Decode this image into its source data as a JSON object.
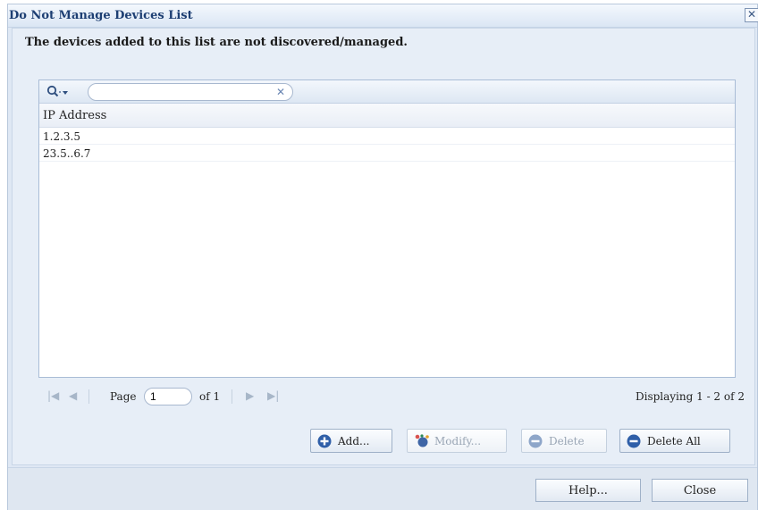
{
  "dialog": {
    "title": "Do Not Manage Devices List",
    "close_icon": "close-icon"
  },
  "description": "The devices added to this list are not discovered/managed.",
  "search": {
    "icon": "search-icon",
    "value": "",
    "clear_icon": "clear-icon"
  },
  "grid": {
    "columns": [
      "IP Address"
    ],
    "rows": [
      "1.2.3.5",
      "23.5..6.7"
    ]
  },
  "pager": {
    "page_label": "Page",
    "page_value": "1",
    "of_label": "of 1",
    "displaying": "Displaying 1 - 2 of 2"
  },
  "actions": {
    "add": "Add...",
    "modify": "Modify...",
    "delete": "Delete",
    "delete_all": "Delete All"
  },
  "footer": {
    "help": "Help...",
    "close": "Close"
  },
  "colors": {
    "title": "#1d3f73",
    "accent": "#2f5fa8",
    "disabled": "#9aa6b5"
  }
}
